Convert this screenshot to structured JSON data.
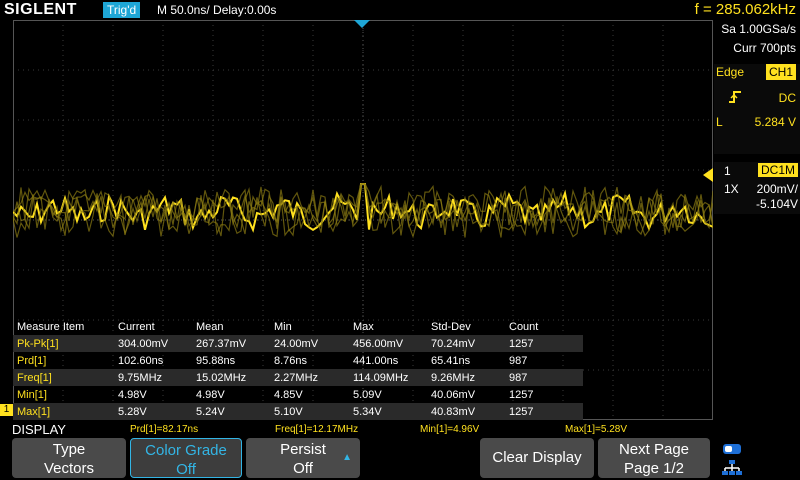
{
  "top": {
    "brand": "SIGLENT",
    "trig_status": "Trig'd",
    "timebase": "M 50.0ns/",
    "delay": "Delay:0.00s",
    "frequency": "f = 285.062kHz"
  },
  "acq": {
    "sample_rate": "Sa 1.00GSa/s",
    "memory": "Curr 700pts"
  },
  "trigger": {
    "type": "Edge",
    "source": "CH1",
    "slope_icon": "rising-edge-icon",
    "coupling": "DC",
    "level_label": "L",
    "level": "5.284 V"
  },
  "channel": {
    "number": "1",
    "coupling": "DC1M",
    "probe": "1X",
    "scale": "200mV/",
    "offset": "-5.104V"
  },
  "measure": {
    "headers": [
      "Measure Item",
      "Current",
      "Mean",
      "Min",
      "Max",
      "Std-Dev",
      "Count"
    ],
    "rows": [
      {
        "name": "Pk-Pk[1]",
        "values": [
          "304.00mV",
          "267.37mV",
          "24.00mV",
          "456.00mV",
          "70.24mV",
          "1257"
        ]
      },
      {
        "name": "Prd[1]",
        "values": [
          "102.60ns",
          "95.88ns",
          "8.76ns",
          "441.00ns",
          "65.41ns",
          "987"
        ]
      },
      {
        "name": "Freq[1]",
        "values": [
          "9.75MHz",
          "15.02MHz",
          "2.27MHz",
          "114.09MHz",
          "9.26MHz",
          "987"
        ]
      },
      {
        "name": "Min[1]",
        "values": [
          "4.98V",
          "4.98V",
          "4.85V",
          "5.09V",
          "40.06mV",
          "1257"
        ]
      },
      {
        "name": "Max[1]",
        "values": [
          "5.28V",
          "5.24V",
          "5.10V",
          "5.34V",
          "40.83mV",
          "1257"
        ]
      }
    ]
  },
  "status": {
    "prd": "Prd[1]=82.17ns",
    "freq": "Freq[1]=12.17MHz",
    "min": "Min[1]=4.96V",
    "max": "Max[1]=5.28V"
  },
  "menu": {
    "title": "DISPLAY",
    "type": {
      "label": "Type",
      "value": "Vectors"
    },
    "color_grade": {
      "label": "Color Grade",
      "value": "Off"
    },
    "persist": {
      "label": "Persist",
      "value": "Off"
    },
    "clear": {
      "label": "Clear Display"
    },
    "next_page": {
      "label": "Next Page",
      "value": "Page 1/2"
    }
  },
  "markers": {
    "ch1_level_marker": "1"
  },
  "colors": {
    "ch1": "#ffe11f",
    "accent": "#1ea6d6"
  }
}
